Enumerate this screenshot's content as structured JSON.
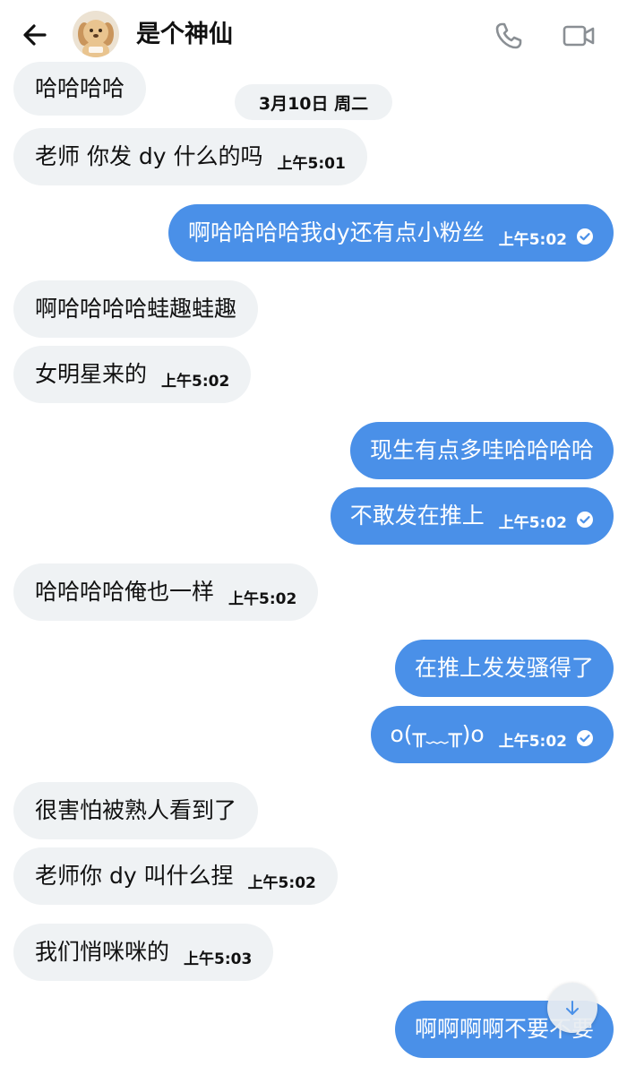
{
  "header": {
    "contact_name": "是个神仙"
  },
  "date_separator": "3月10日 周二",
  "messages": [
    {
      "direction": "in",
      "text": "哈哈哈哈",
      "time": ""
    },
    {
      "direction": "in",
      "text": "老师 你发 dy 什么的吗",
      "time": "上午5:01"
    },
    {
      "direction": "out",
      "text": "啊哈哈哈哈我dy还有点小粉丝",
      "time": "上午5:02",
      "status": "read"
    },
    {
      "direction": "in",
      "text": "啊哈哈哈哈蛙趣蛙趣",
      "time": ""
    },
    {
      "direction": "in",
      "text": "女明星来的",
      "time": "上午5:02"
    },
    {
      "direction": "out",
      "text": "现生有点多哇哈哈哈哈",
      "time": ""
    },
    {
      "direction": "out",
      "text": "不敢发在推上",
      "time": "上午5:02",
      "status": "read"
    },
    {
      "direction": "in",
      "text": "哈哈哈哈俺也一样",
      "time": "上午5:02"
    },
    {
      "direction": "out",
      "text": "在推上发发骚得了",
      "time": ""
    },
    {
      "direction": "out",
      "text": "o(╥﹏╥)o",
      "time": "上午5:02",
      "status": "read"
    },
    {
      "direction": "in",
      "text": "很害怕被熟人看到了",
      "time": ""
    },
    {
      "direction": "in",
      "text": "老师你 dy 叫什么捏",
      "time": "上午5:02"
    },
    {
      "direction": "in",
      "text": "我们悄咪咪的",
      "time": "上午5:03"
    },
    {
      "direction": "out",
      "text": "啊啊啊啊不要不要",
      "time": ""
    }
  ],
  "icons": {
    "back": "arrow-left-icon",
    "call": "phone-icon",
    "video": "video-camera-icon",
    "read_status": "check-circle-icon",
    "scroll": "arrow-down-icon"
  },
  "colors": {
    "outgoing_bubble": "#4a90e8",
    "incoming_bubble": "#eff2f4",
    "header_icons": "#8a8f94"
  }
}
